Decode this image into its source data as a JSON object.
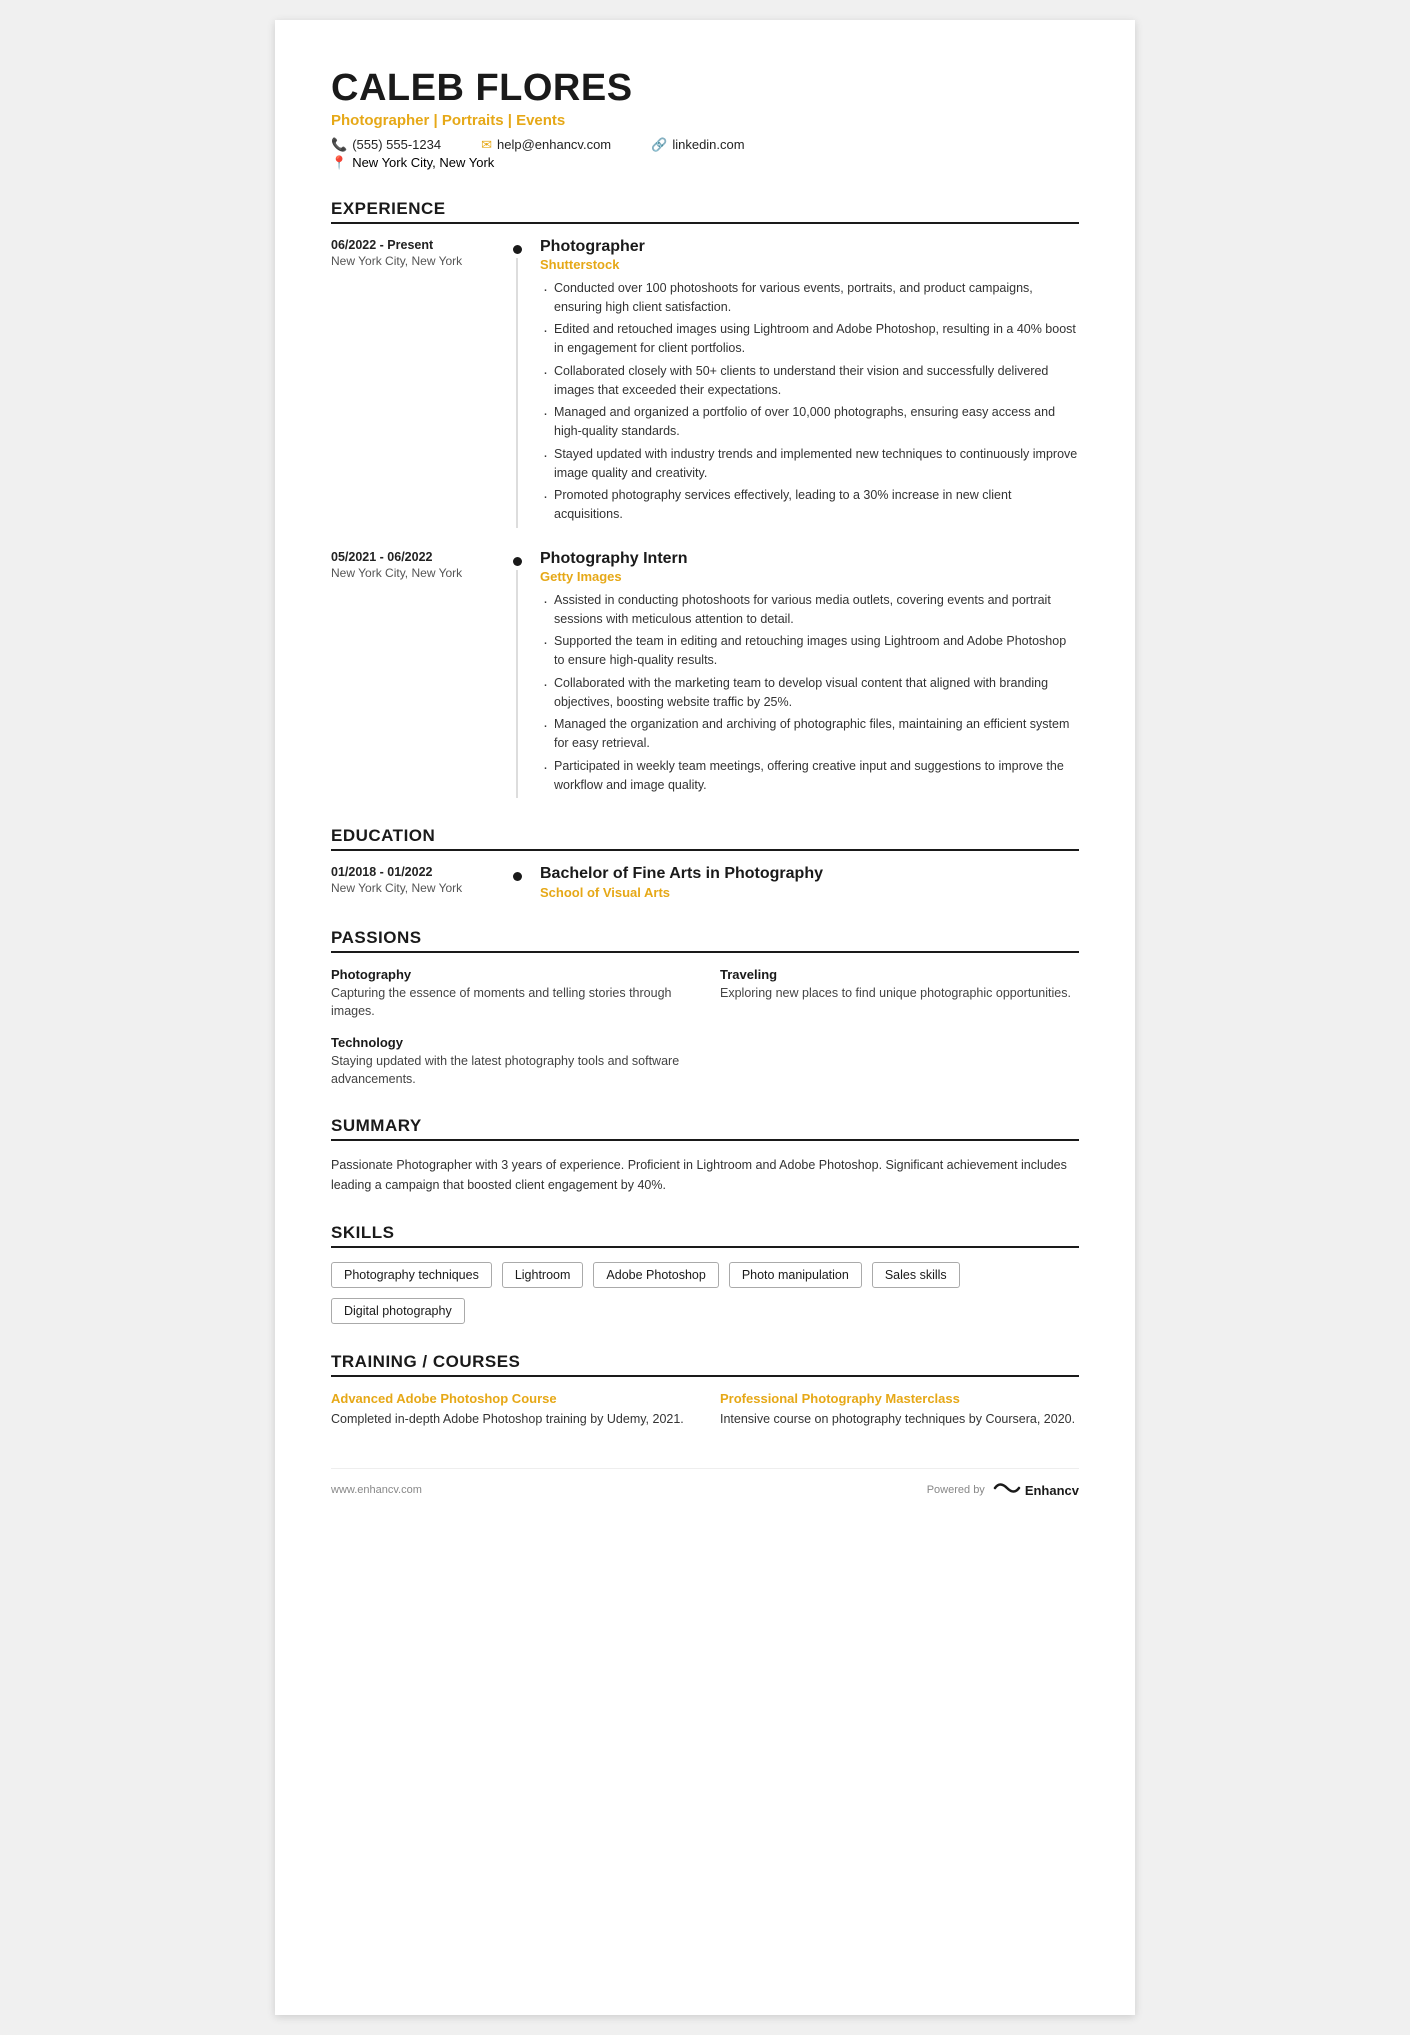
{
  "header": {
    "name": "CALEB FLORES",
    "title": "Photographer | Portraits | Events",
    "phone": "(555) 555-1234",
    "email": "help@enhancv.com",
    "linkedin": "linkedin.com",
    "location": "New York City, New York"
  },
  "sections": {
    "experience": {
      "label": "EXPERIENCE",
      "items": [
        {
          "date": "06/2022 - Present",
          "location": "New York City, New York",
          "job_title": "Photographer",
          "company": "Shutterstock",
          "bullets": [
            "Conducted over 100 photoshoots for various events, portraits, and product campaigns, ensuring high client satisfaction.",
            "Edited and retouched images using Lightroom and Adobe Photoshop, resulting in a 40% boost in engagement for client portfolios.",
            "Collaborated closely with 50+ clients to understand their vision and successfully delivered images that exceeded their expectations.",
            "Managed and organized a portfolio of over 10,000 photographs, ensuring easy access and high-quality standards.",
            "Stayed updated with industry trends and implemented new techniques to continuously improve image quality and creativity.",
            "Promoted photography services effectively, leading to a 30% increase in new client acquisitions."
          ]
        },
        {
          "date": "05/2021 - 06/2022",
          "location": "New York City, New York",
          "job_title": "Photography Intern",
          "company": "Getty Images",
          "bullets": [
            "Assisted in conducting photoshoots for various media outlets, covering events and portrait sessions with meticulous attention to detail.",
            "Supported the team in editing and retouching images using Lightroom and Adobe Photoshop to ensure high-quality results.",
            "Collaborated with the marketing team to develop visual content that aligned with branding objectives, boosting website traffic by 25%.",
            "Managed the organization and archiving of photographic files, maintaining an efficient system for easy retrieval.",
            "Participated in weekly team meetings, offering creative input and suggestions to improve the workflow and image quality."
          ]
        }
      ]
    },
    "education": {
      "label": "EDUCATION",
      "items": [
        {
          "date": "01/2018 - 01/2022",
          "location": "New York City, New York",
          "degree": "Bachelor of Fine Arts in Photography",
          "school": "School of Visual Arts"
        }
      ]
    },
    "passions": {
      "label": "PASSIONS",
      "items": [
        {
          "title": "Photography",
          "desc": "Capturing the essence of moments and telling stories through images."
        },
        {
          "title": "Traveling",
          "desc": "Exploring new places to find unique photographic opportunities."
        },
        {
          "title": "Technology",
          "desc": "Staying updated with the latest photography tools and software advancements."
        }
      ]
    },
    "summary": {
      "label": "SUMMARY",
      "text": "Passionate Photographer with 3 years of experience. Proficient in Lightroom and Adobe Photoshop. Significant achievement includes leading a campaign that boosted client engagement by 40%."
    },
    "skills": {
      "label": "SKILLS",
      "items": [
        "Photography techniques",
        "Lightroom",
        "Adobe Photoshop",
        "Photo manipulation",
        "Sales skills",
        "Digital photography"
      ]
    },
    "training": {
      "label": "TRAINING / COURSES",
      "items": [
        {
          "title": "Advanced Adobe Photoshop Course",
          "desc": "Completed in-depth Adobe Photoshop training by Udemy, 2021."
        },
        {
          "title": "Professional Photography Masterclass",
          "desc": "Intensive course on photography techniques by Coursera, 2020."
        }
      ]
    }
  },
  "footer": {
    "url": "www.enhancv.com",
    "powered_by": "Powered by",
    "brand": "Enhancv"
  }
}
